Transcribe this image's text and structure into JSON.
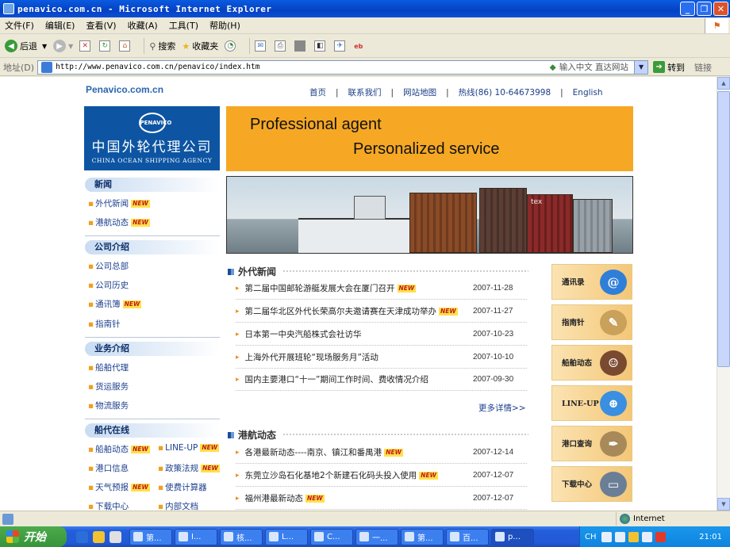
{
  "window": {
    "title": "penavico.com.cn - Microsoft Internet Explorer",
    "controls": [
      "_",
      "❐",
      "✕"
    ]
  },
  "menu": [
    "文件(F)",
    "编辑(E)",
    "查看(V)",
    "收藏(A)",
    "工具(T)",
    "帮助(H)"
  ],
  "toolbar": {
    "back": "后退",
    "search": "搜索",
    "favorites": "收藏夹"
  },
  "address": {
    "label": "地址(D)",
    "url": "http://www.penavico.com.cn/penavico/index.htm",
    "hint": "输入中文 直达网站",
    "go": "转到",
    "links": "链接"
  },
  "page": {
    "site_name": "Penavico.com.cn",
    "topnav": [
      "首页",
      "联系我们",
      "网站地图",
      "热线(86) 10-64673998",
      "English"
    ],
    "brand_cn": "中国外轮代理公司",
    "brand_en": "CHINA OCEAN SHIPPING AGENCY",
    "brand_emblem": "PENAVICO",
    "banner_line1": "Professional agent",
    "banner_line2": "Personalized service",
    "photo_label": "tex",
    "new_tag": "NEW",
    "sidebar": [
      {
        "title": "新闻",
        "items": [
          {
            "label": "外代新闻",
            "new": true
          },
          {
            "label": "港航动态",
            "new": true
          }
        ]
      },
      {
        "title": "公司介绍",
        "items": [
          {
            "label": "公司总部",
            "new": false
          },
          {
            "label": "公司历史",
            "new": false
          },
          {
            "label": "通讯簿",
            "new": true
          },
          {
            "label": "指南针",
            "new": false
          }
        ]
      },
      {
        "title": "业务介绍",
        "items": [
          {
            "label": "船舶代理",
            "new": false
          },
          {
            "label": "货运服务",
            "new": false
          },
          {
            "label": "物流服务",
            "new": false
          }
        ]
      },
      {
        "title": "船代在线",
        "items": [
          {
            "label": "船舶动态",
            "new": true
          },
          {
            "label": "LINE-UP",
            "new": true
          },
          {
            "label": "港口信息",
            "new": false
          },
          {
            "label": "政策法规",
            "new": true
          },
          {
            "label": "天气预报",
            "new": true
          },
          {
            "label": "使费计算器",
            "new": false
          },
          {
            "label": "下载中心",
            "new": false
          },
          {
            "label": "内部文档",
            "new": false
          }
        ]
      }
    ],
    "news_section": {
      "title": "外代新闻",
      "items": [
        {
          "title": "第二届中国邮轮游艇发展大会在厦门召开",
          "new": true,
          "date": "2007-11-28"
        },
        {
          "title": "第二届华北区外代长荣高尔夫邀请赛在天津成功举办",
          "new": true,
          "date": "2007-11-27"
        },
        {
          "title": "日本第一中央汽船株式会社访华",
          "new": false,
          "date": "2007-10-23"
        },
        {
          "title": "上海外代开展班轮“现场服务月”活动",
          "new": false,
          "date": "2007-10-10"
        },
        {
          "title": "国内主要港口“十一”期间工作时间、费收情况介绍",
          "new": false,
          "date": "2007-09-30"
        }
      ],
      "more": "更多详情>>"
    },
    "port_section": {
      "title": "港航动态",
      "items": [
        {
          "title": "各港最新动态----南京、镇江和番禺港",
          "new": true,
          "date": "2007-12-14"
        },
        {
          "title": "东莞立沙岛石化基地2个新建石化码头投入使用",
          "new": true,
          "date": "2007-12-07"
        },
        {
          "title": "福州港最新动态",
          "new": true,
          "date": "2007-12-07"
        }
      ]
    },
    "tiles": [
      {
        "label": "通讯录",
        "icon": "@"
      },
      {
        "label": "指南针",
        "icon": "✎"
      },
      {
        "label": "船舶动态",
        "icon": "☺"
      },
      {
        "label": "LINE-UP",
        "icon": "⊕"
      },
      {
        "label": "港口查询",
        "icon": "✒"
      },
      {
        "label": "下载中心",
        "icon": "▭"
      }
    ]
  },
  "status": {
    "zone": "Internet"
  },
  "taskbar": {
    "start": "开始",
    "tasks": [
      "第...",
      "I...",
      "核...",
      "L...",
      "C...",
      "一...",
      "第...",
      "百...",
      "p..."
    ],
    "lang": "CH",
    "clock": "21:01"
  },
  "colors": {
    "brand_blue": "#0d55a3",
    "banner_orange": "#f6a825",
    "link_blue": "#1c3f8e"
  }
}
